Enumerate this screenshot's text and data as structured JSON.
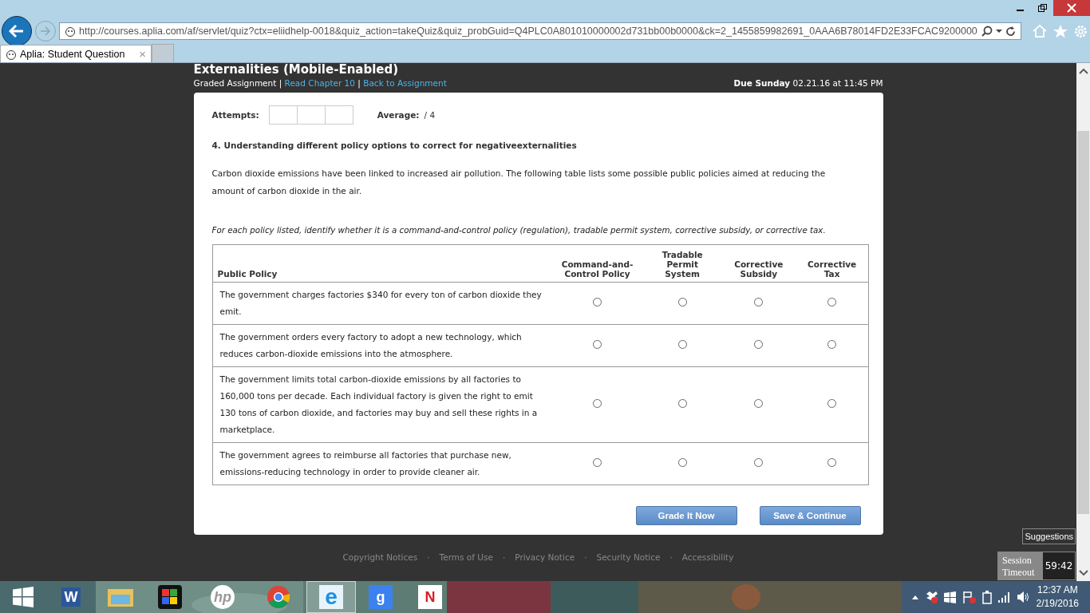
{
  "browser": {
    "url": "http://courses.aplia.com/af/servlet/quiz?ctx=eliidhelp-0018&quiz_action=takeQuiz&quiz_probGuid=Q4PLC0A801010000002d731bb00b0000&ck=2_1455859982691_0AAA6B78014FD2E33FCAC9200000",
    "tab_title": "Aplia: Student Question",
    "tab_close": "×"
  },
  "page": {
    "title": "Externalities (Mobile-Enabled)",
    "breadcrumb": {
      "label": "Graded Assignment",
      "separator": "|",
      "links": [
        "Read Chapter 10",
        "Back to Assignment"
      ]
    },
    "due": {
      "label": "Due Sunday",
      "value": "02.21.16 at 11:45 PM"
    }
  },
  "question": {
    "attempts_label": "Attempts:",
    "average_label": "Average:",
    "average_value": "/ 4",
    "title": "4. Understanding different policy options to correct for negativeexternalities",
    "intro": "Carbon dioxide emissions have been linked to increased air pollution. The following table lists some possible public policies aimed at reducing the amount of carbon dioxide in the air.",
    "instructions": "For each policy listed, identify whether it is a command-and-control policy (regulation), tradable permit system, corrective subsidy, or corrective tax.",
    "table": {
      "columns": [
        "Public Policy",
        "Command-and-Control Policy",
        "Tradable Permit System",
        "Corrective Subsidy",
        "Corrective Tax"
      ],
      "rows": [
        {
          "policy": "The government charges factories $340 for every ton of carbon dioxide they emit.",
          "choices": [
            {
              "selected": false
            },
            {
              "selected": false
            },
            {
              "selected": false
            },
            {
              "selected": false
            }
          ]
        },
        {
          "policy": "The government orders every factory to adopt a new technology, which reduces carbon-dioxide emissions into the atmosphere.",
          "choices": [
            {
              "selected": false
            },
            {
              "selected": false
            },
            {
              "selected": false
            },
            {
              "selected": false
            }
          ]
        },
        {
          "policy": "The government limits total carbon-dioxide emissions by all factories to 160,000 tons per decade. Each individual factory is given the right to emit 130 tons of carbon dioxide, and factories may buy and sell these rights in a marketplace.",
          "choices": [
            {
              "selected": false
            },
            {
              "selected": false
            },
            {
              "selected": false
            },
            {
              "selected": false
            }
          ]
        },
        {
          "policy": "The government agrees to reimburse all factories that purchase new, emissions-reducing technology in order to provide cleaner air.",
          "choices": [
            {
              "selected": false
            },
            {
              "selected": false
            },
            {
              "selected": false
            },
            {
              "selected": false
            }
          ]
        }
      ]
    },
    "buttons": [
      "Grade It Now",
      "Save & Continue"
    ]
  },
  "footer": {
    "links": [
      "Copyright Notices",
      "Terms of Use",
      "Privacy Notice",
      "Security Notice",
      "Accessibility"
    ],
    "separator": "·"
  },
  "suggestions": "Suggestions",
  "session": {
    "label": "Session Timeout",
    "time": "59:42"
  },
  "taskbar": {
    "apps": [
      {
        "kind": "word",
        "glyph": "W"
      },
      {
        "kind": "folder"
      },
      {
        "kind": "puzzle"
      },
      {
        "kind": "hp",
        "glyph": "hp"
      },
      {
        "kind": "chrome"
      },
      {
        "kind": "ie",
        "glyph": "e",
        "selected": true
      },
      {
        "kind": "google",
        "glyph": "g"
      },
      {
        "kind": "netflix",
        "glyph": "N"
      }
    ],
    "time": "12:37 AM",
    "date": "2/19/2016"
  }
}
